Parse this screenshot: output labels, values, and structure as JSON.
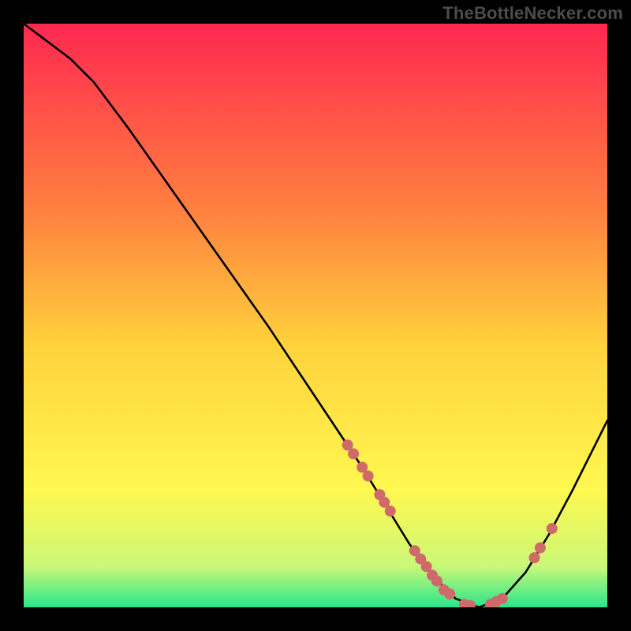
{
  "watermark": "TheBottleNecker.com",
  "chart_data": {
    "type": "line",
    "title": "",
    "xlabel": "",
    "ylabel": "",
    "xlim": [
      0,
      100
    ],
    "ylim": [
      0,
      100
    ],
    "grid": false,
    "series": [
      {
        "name": "bottleneck-curve",
        "color": "#000000",
        "x": [
          0,
          4,
          8,
          12,
          18,
          24,
          30,
          36,
          42,
          48,
          54,
          58,
          62,
          66,
          70,
          74,
          78,
          82,
          86,
          90,
          94,
          98,
          100
        ],
        "y": [
          100,
          97,
          94,
          90,
          82,
          73.5,
          65,
          56.5,
          48,
          39,
          30,
          24,
          17.5,
          11,
          5.5,
          1.5,
          0,
          1.5,
          6,
          12.5,
          20,
          28,
          32
        ]
      }
    ],
    "markers": {
      "name": "highlighted-points",
      "color": "#d06a6a",
      "x": [
        55.5,
        56.5,
        58.0,
        59.0,
        61.0,
        61.8,
        62.8,
        67.0,
        68.0,
        69.0,
        70.0,
        70.8,
        72.0,
        73.0,
        75.5,
        76.5,
        80.0,
        81.0,
        82.0,
        87.5,
        88.5,
        90.5
      ],
      "y": [
        27.8,
        26.3,
        24.0,
        22.5,
        19.3,
        18.0,
        16.5,
        9.7,
        8.3,
        7.0,
        5.5,
        4.5,
        3.0,
        2.3,
        0.5,
        0.3,
        0.5,
        1.0,
        1.5,
        8.5,
        10.2,
        13.5
      ]
    },
    "background_gradient": {
      "top": "#ff2850",
      "mid_upper": "#ff8040",
      "mid": "#ffd23c",
      "mid_lower": "#fff850",
      "near_bottom": "#caf878",
      "bottom": "#28e68c"
    }
  }
}
